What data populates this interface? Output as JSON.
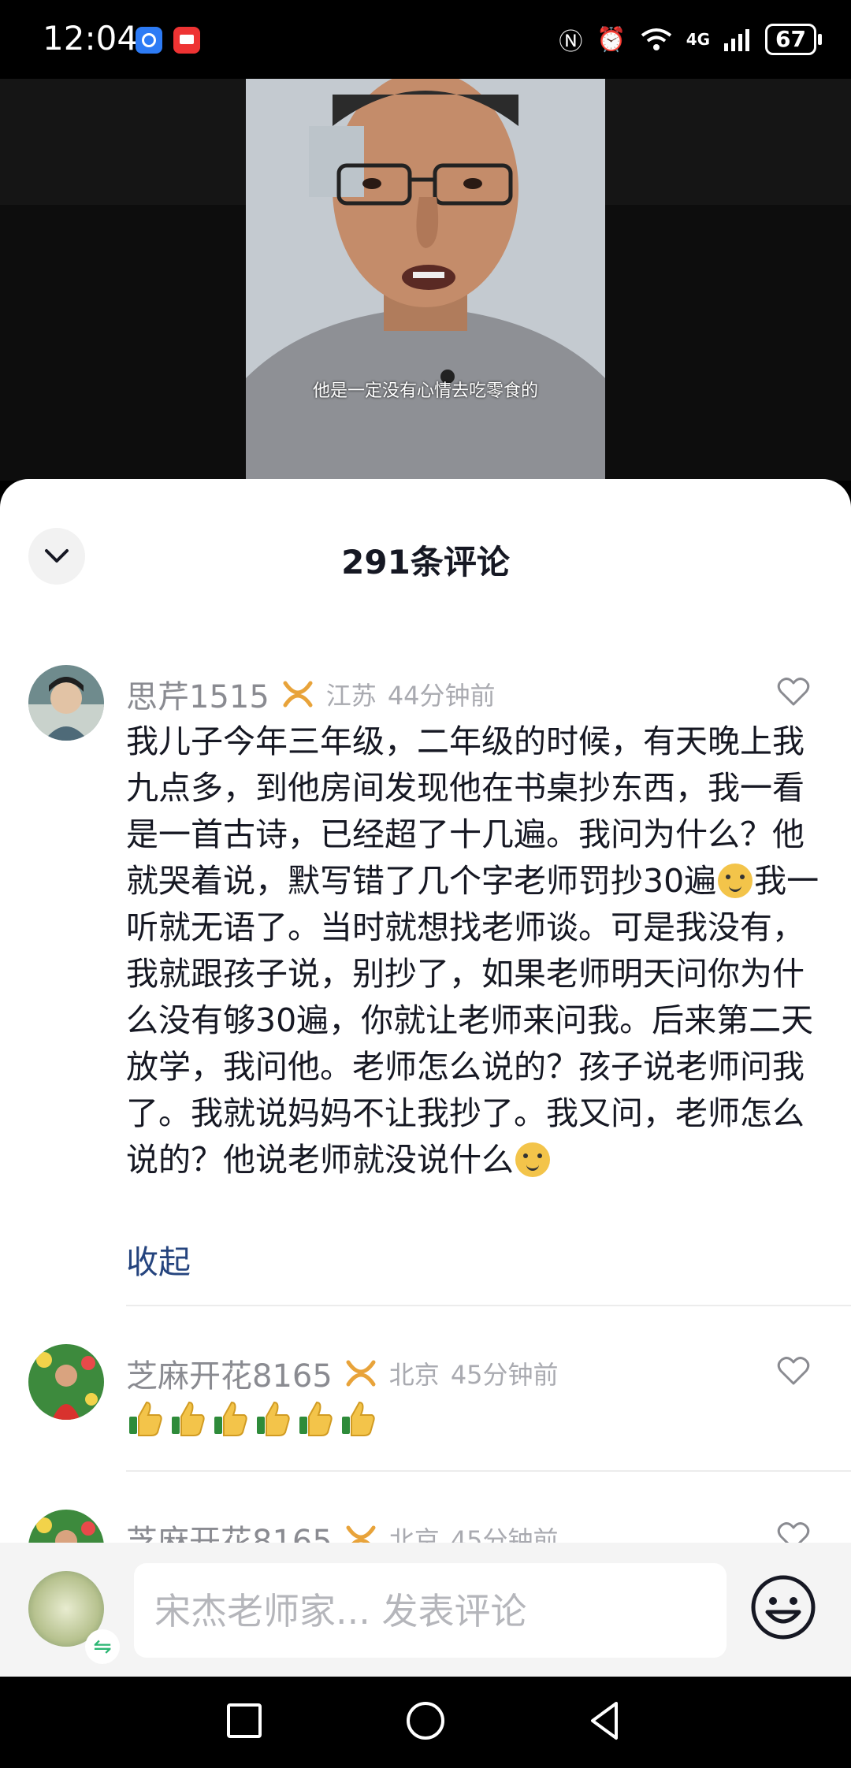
{
  "status_bar": {
    "time": "12:04",
    "battery": "67",
    "network": "4G"
  },
  "video": {
    "subtitle": "他是一定没有心情去吃零食的"
  },
  "comments_header": {
    "title": "291条评论"
  },
  "comments": [
    {
      "username": "思芹1515",
      "location": "江苏",
      "time_ago": "44分钟前",
      "text_parts": [
        "我儿子今年三年级，二年级的时候，有天晚上我九点多，到他房间发现他在书桌抄东西，我一看是一首古诗，已经超了十几遍。我问为什么？他就哭着说，默写错了几个字老师罚抄30遍",
        "我一听就无语了。当时就想找老师谈。可是我没有，我就跟孩子说，别抄了，如果老师明天问你为什么没有够30遍，你就让老师来问我。后来第二天放学，我问他。老师怎么说的？孩子说老师问我了。我就说妈妈不让我抄了。我又问，老师怎么说的？他说老师就没说什么"
      ],
      "collapse_label": "收起"
    },
    {
      "username": "芝麻开花8165",
      "location": "北京",
      "time_ago": "45分钟前",
      "thumbs_count": 6
    },
    {
      "username": "芝麻开花8165",
      "location": "北京",
      "time_ago": "45分钟前"
    }
  ],
  "input_bar": {
    "placeholder": "宋杰老师家... 发表评论"
  },
  "colors": {
    "sheet": "#ffffff",
    "name_gray": "#8a8b91",
    "link_blue": "#25447e",
    "badge_gold": "#e8a33a"
  }
}
